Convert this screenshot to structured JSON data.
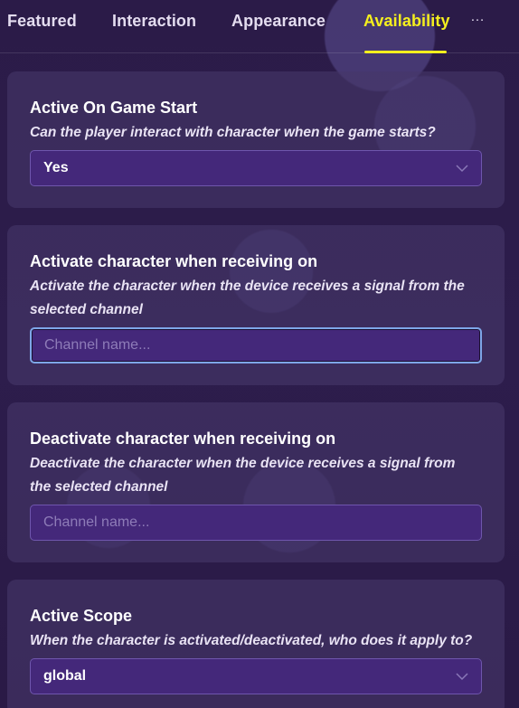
{
  "tabs": [
    {
      "label": "Featured"
    },
    {
      "label": "Interaction"
    },
    {
      "label": "Appearance"
    },
    {
      "label": "Availability"
    }
  ],
  "active_tab": "Availability",
  "more_icon": "…",
  "sections": {
    "game_start": {
      "title": "Active On Game Start",
      "description": "Can the player interact with character when the game starts?",
      "value": "Yes"
    },
    "activate_channel": {
      "title": "Activate character when receiving on",
      "description": "Activate the character when the device receives a signal from the selected channel",
      "placeholder": "Channel name..."
    },
    "deactivate_channel": {
      "title": "Deactivate character when receiving on",
      "description": "Deactivate the character when the device receives a signal from the selected channel",
      "placeholder": "Channel name..."
    },
    "scope": {
      "title": "Active Scope",
      "description": "When the character is activated/deactivated, who does it apply to?",
      "value": "global"
    }
  },
  "colors": {
    "accent": "#f5ef1e",
    "card_bg": "#463769",
    "field_bg": "#44287a",
    "focus_border": "#7ea6e8"
  },
  "icons": {
    "dropdown": "chevron-down-icon"
  }
}
